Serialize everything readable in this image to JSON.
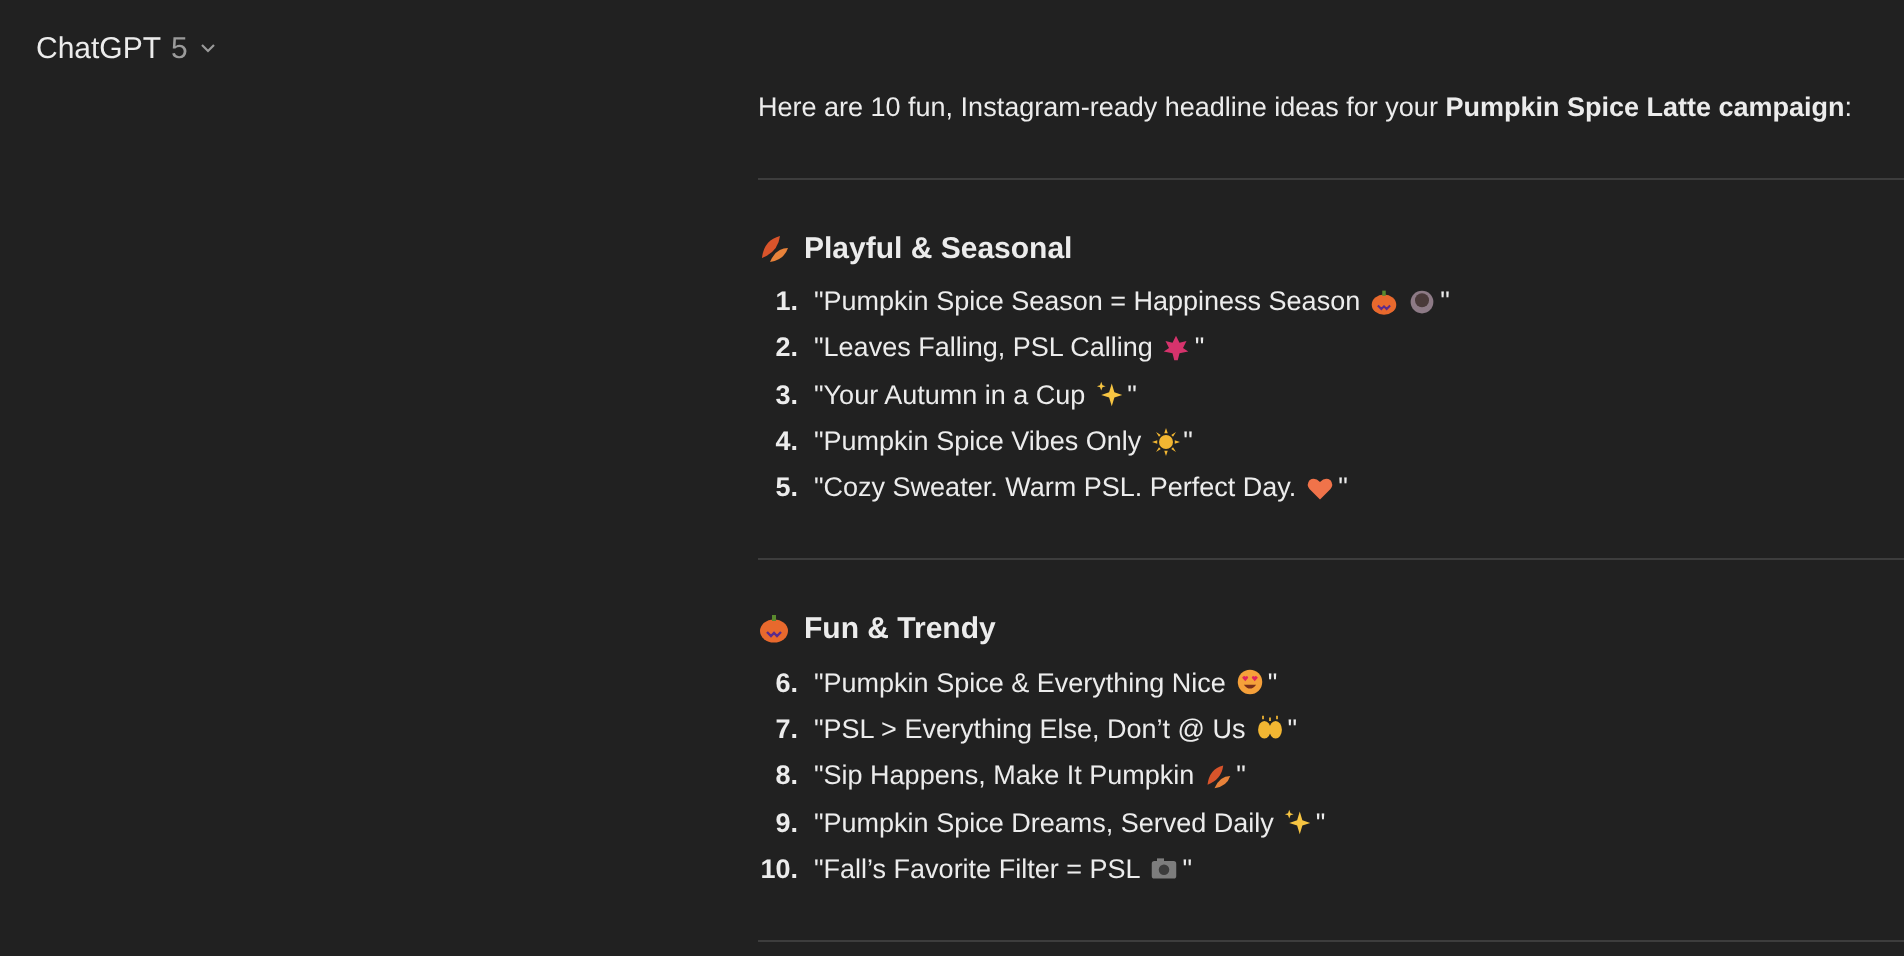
{
  "header": {
    "title": "ChatGPT",
    "version": "5"
  },
  "intro": "Here are 10 fun, Instagram-ready headline ideas for your **Pumpkin Spice Latte campaign**:",
  "sections": [
    {
      "heading": "Playful & Seasonal",
      "items": [
        {
          "number": "1.",
          "text": "\"Pumpkin Spice Season = Happiness Season",
          "closing": "\""
        },
        {
          "number": "2.",
          "text": "\"Leaves Falling, PSL Calling",
          "closing": "\""
        },
        {
          "number": "3.",
          "text": "\"Your Autumn in a Cup",
          "closing": "\""
        },
        {
          "number": "4.",
          "text": "\"Pumpkin Spice Vibes Only",
          "closing": "\""
        },
        {
          "number": "5.",
          "text": "\"Cozy Sweater. Warm PSL. Perfect Day.",
          "closing": "\""
        }
      ]
    },
    {
      "heading": "Fun & Trendy",
      "items": [
        {
          "number": "6.",
          "text": "\"Pumpkin Spice & Everything Nice",
          "closing": "\""
        },
        {
          "number": "7.",
          "text": "\"PSL > Everything Else, Don’t @ Us",
          "closing": "\""
        },
        {
          "number": "8.",
          "text": "\"Sip Happens, Make It Pumpkin",
          "closing": "\""
        },
        {
          "number": "9.",
          "text": "\"Pumpkin Spice Dreams, Served Daily",
          "closing": "\""
        },
        {
          "number": "10.",
          "text": "\"Fall’s Favorite Filter = PSL",
          "closing": "\""
        }
      ]
    }
  ]
}
